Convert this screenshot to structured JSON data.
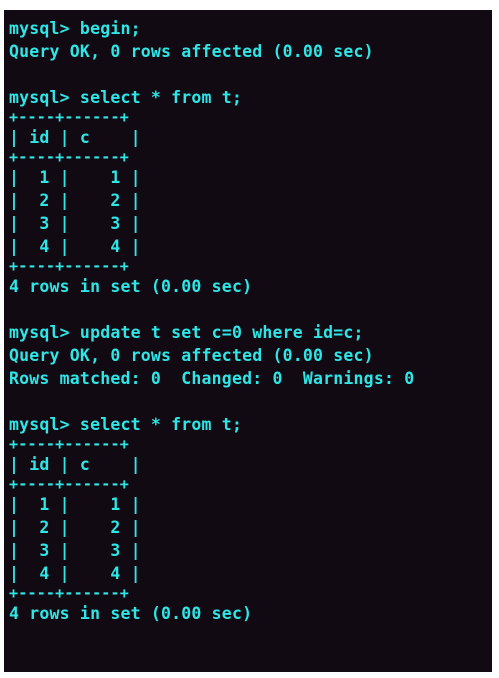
{
  "terminal": {
    "accent_color": "#2ee6e6",
    "background_color": "#120a13",
    "lines": [
      {
        "kind": "text",
        "text": "mysql> begin;"
      },
      {
        "kind": "text",
        "text": "Query OK, 0 rows affected (0.00 sec)"
      },
      {
        "kind": "blank",
        "text": ""
      },
      {
        "kind": "text",
        "text": "mysql> select * from t;"
      },
      {
        "kind": "border",
        "text": "+----+------+"
      },
      {
        "kind": "text",
        "text": "| id | c    |"
      },
      {
        "kind": "border",
        "text": "+----+------+"
      },
      {
        "kind": "text",
        "text": "|  1 |    1 |"
      },
      {
        "kind": "text",
        "text": "|  2 |    2 |"
      },
      {
        "kind": "text",
        "text": "|  3 |    3 |"
      },
      {
        "kind": "text",
        "text": "|  4 |    4 |"
      },
      {
        "kind": "border",
        "text": "+----+------+"
      },
      {
        "kind": "text",
        "text": "4 rows in set (0.00 sec)"
      },
      {
        "kind": "blank",
        "text": ""
      },
      {
        "kind": "text",
        "text": "mysql> update t set c=0 where id=c;"
      },
      {
        "kind": "text",
        "text": "Query OK, 0 rows affected (0.00 sec)"
      },
      {
        "kind": "text",
        "text": "Rows matched: 0  Changed: 0  Warnings: 0"
      },
      {
        "kind": "blank",
        "text": ""
      },
      {
        "kind": "text",
        "text": "mysql> select * from t;"
      },
      {
        "kind": "border",
        "text": "+----+------+"
      },
      {
        "kind": "text",
        "text": "| id | c    |"
      },
      {
        "kind": "border",
        "text": "+----+------+"
      },
      {
        "kind": "text",
        "text": "|  1 |    1 |"
      },
      {
        "kind": "text",
        "text": "|  2 |    2 |"
      },
      {
        "kind": "text",
        "text": "|  3 |    3 |"
      },
      {
        "kind": "text",
        "text": "|  4 |    4 |"
      },
      {
        "kind": "border",
        "text": "+----+------+"
      },
      {
        "kind": "text",
        "text": "4 rows in set (0.00 sec)"
      }
    ]
  }
}
